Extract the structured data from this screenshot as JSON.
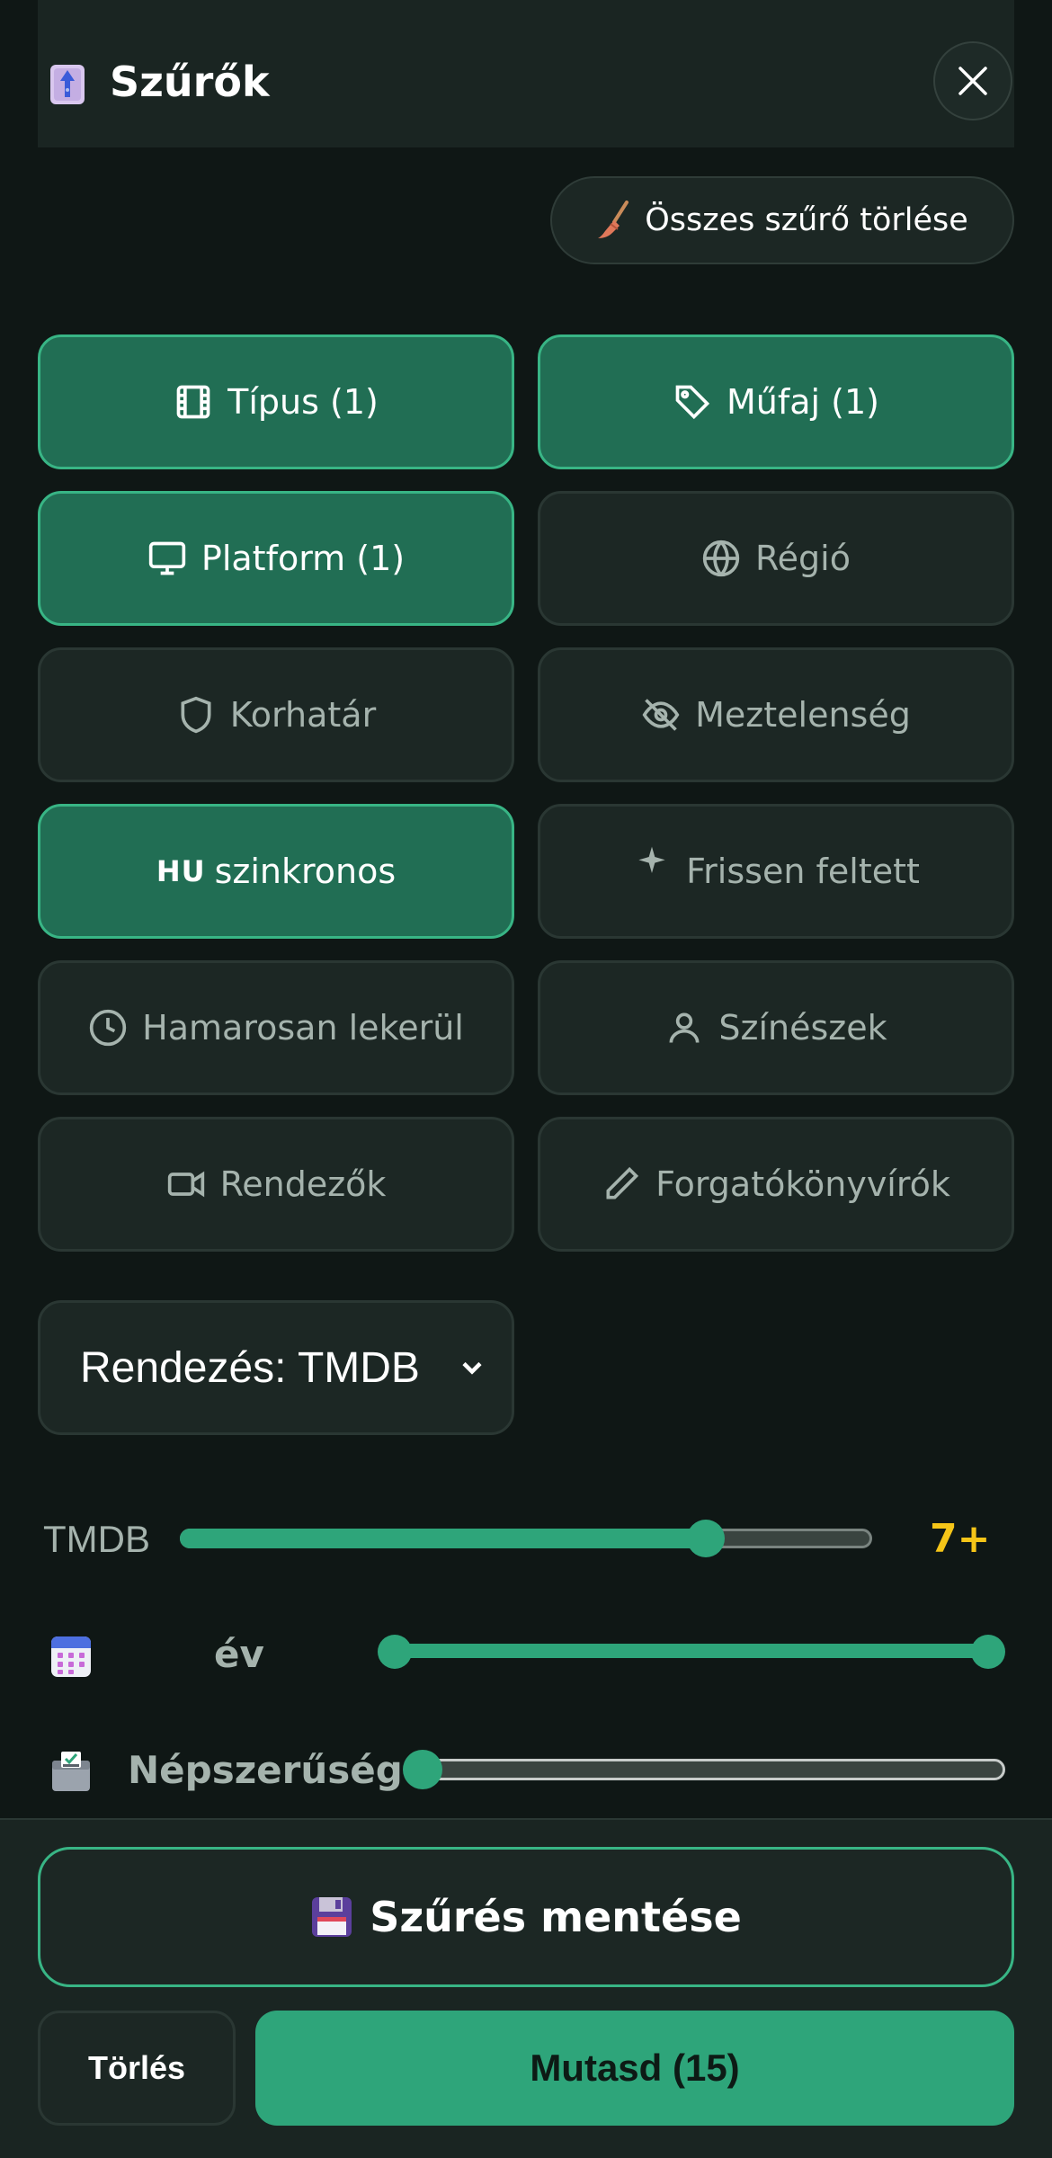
{
  "header": {
    "title": "Szűrők",
    "icon": "filter-emoji-icon",
    "close_icon": "close-icon"
  },
  "clear_all": {
    "label": "Összes szűrő törlése",
    "icon": "broom-icon"
  },
  "filters": [
    {
      "label": "Típus (1)",
      "icon": "film-icon",
      "active": true
    },
    {
      "label": "Műfaj (1)",
      "icon": "tag-icon",
      "active": true
    },
    {
      "label": "Platform (1)",
      "icon": "monitor-icon",
      "active": true
    },
    {
      "label": "Régió",
      "icon": "globe-icon",
      "active": false
    },
    {
      "label": "Korhatár",
      "icon": "shield-icon",
      "active": false
    },
    {
      "label": "Meztelenség",
      "icon": "eye-off-icon",
      "active": false
    },
    {
      "label": "szinkronos",
      "prefix": "HU",
      "active": true
    },
    {
      "label": "Frissen feltett",
      "icon": "sparkle-icon",
      "active": false
    },
    {
      "label": "Hamarosan lekerül",
      "icon": "clock-icon",
      "active": false
    },
    {
      "label": "Színészek",
      "icon": "user-icon",
      "active": false
    },
    {
      "label": "Rendezők",
      "icon": "video-icon",
      "active": false
    },
    {
      "label": "Forgatókönyvírók",
      "icon": "pencil-icon",
      "active": false
    }
  ],
  "sort": {
    "label": "Rendezés: TMDB"
  },
  "tmdb_slider": {
    "label": "TMDB",
    "value_text": "7+",
    "fraction": 0.76
  },
  "year_slider": {
    "label": "év",
    "icon": "calendar-icon",
    "range": [
      0,
      1
    ]
  },
  "popularity_slider": {
    "label": "Népszerűség",
    "icon": "ballot-box-icon",
    "fraction": 0
  },
  "footer": {
    "save_label": "Szűrés mentése",
    "save_icon": "floppy-disk-icon",
    "delete_label": "Törlés",
    "show_label": "Mutasd (15)"
  },
  "colors": {
    "background": "#0f1715",
    "accent": "#2ea57a",
    "active_button": "#216e54",
    "rating_gold": "#f5c518"
  }
}
